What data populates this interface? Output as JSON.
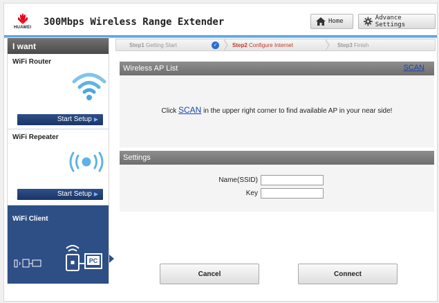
{
  "header": {
    "logo_text": "HUAWEI",
    "title": "300Mbps Wireless Range Extender",
    "home_label": "Home",
    "advance_label": "Advance Settings"
  },
  "sidebar": {
    "heading": "I want",
    "cards": [
      {
        "title": "WiFi Router",
        "button": "Start Setup",
        "icon": "wifi-router-icon"
      },
      {
        "title": "WiFi Repeater",
        "button": "Start Setup",
        "icon": "wifi-repeater-icon"
      },
      {
        "title": "WiFi Client",
        "icon": "wifi-client-icon",
        "active": true,
        "illustration_label": "PC"
      }
    ]
  },
  "steps": [
    {
      "num": "Step1",
      "label": "Getting Start",
      "state": "done"
    },
    {
      "num": "Step2",
      "label": "Configure Internet",
      "state": "current"
    },
    {
      "num": "Step3",
      "label": "Finish",
      "state": "pending"
    }
  ],
  "ap_list": {
    "title": "Wireless AP List",
    "scan_label": "SCAN",
    "msg_before": "Click ",
    "msg_link": "SCAN",
    "msg_after": " in the upper right corner to find available AP in your near side!"
  },
  "settings": {
    "title": "Settings",
    "ssid_label": "Name(SSID)",
    "ssid_value": "",
    "key_label": "Key",
    "key_value": ""
  },
  "actions": {
    "cancel": "Cancel",
    "connect": "Connect"
  },
  "colors": {
    "accent": "#2c8fd8",
    "sidebar_active": "#2d4f86",
    "step_current": "#c0392b",
    "brand": "#e60012"
  }
}
